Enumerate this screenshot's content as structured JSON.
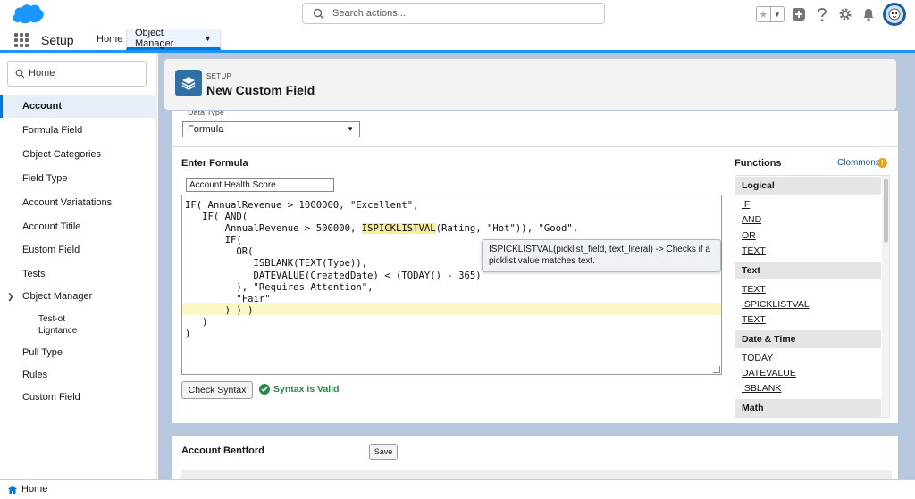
{
  "header": {
    "search_placeholder": "Search actions...",
    "icons": [
      "salesforce-cloud-logo",
      "star-icon",
      "plus-icon",
      "help-icon",
      "gear-icon",
      "bell-icon",
      "avatar"
    ]
  },
  "nav": {
    "app_name": "Setup",
    "tabs": [
      {
        "label": "Home"
      },
      {
        "label": "Object Manager"
      }
    ]
  },
  "sidebar": {
    "quickfind_value": "Home",
    "items": [
      {
        "label": "Account"
      },
      {
        "label": "Formula Field"
      },
      {
        "label": "Object Categories"
      },
      {
        "label": "Field Type"
      },
      {
        "label": "Account Variatations"
      },
      {
        "label": "Account Titile"
      },
      {
        "label": "Eustom Field"
      },
      {
        "label": "Tests"
      },
      {
        "label": "Object Manager"
      },
      {
        "label": "Test-ot"
      },
      {
        "label": "Ligntance"
      },
      {
        "label": "Pull Type"
      },
      {
        "label": "Rules"
      },
      {
        "label": "Custom Field"
      }
    ]
  },
  "page_header": {
    "eyebrow": "SETUP",
    "title": "New Custom Field"
  },
  "data_type": {
    "label": "Data Type",
    "value": "Formula"
  },
  "formula": {
    "section_title": "Enter Formula",
    "field_name": "Account Health Score",
    "code_lines": [
      "IF( AnnualRevenue > 1000000, \"Excellent\",",
      "   IF( AND(",
      "       AnnualRevenue > 500000, ",
      "       IF(",
      "         OR(",
      "            ISBLANK(TEXT(Type)),",
      "            DATEVALUE(CreatedDate) < (TODAY() - 365)",
      "         ), \"Requires Attention\",",
      "         \"Fair\"",
      "       ) ) )",
      "   )",
      ")"
    ],
    "code_line2_fn": "ISPICKLISTVAL",
    "code_line2_rest": "(Rating, \"Hot\")), \"Good\",",
    "tooltip": "ISPICKLISTVAL(picklist_field, text_literal) -> Checks if a picklist value matches text.",
    "check_button": "Check Syntax",
    "valid_text": "Syntax is Valid"
  },
  "functions": {
    "title": "Functions",
    "link": "Clommons",
    "categories": [
      {
        "name": "Logical",
        "items": [
          "IF",
          "AND",
          "OR",
          "TEXT"
        ]
      },
      {
        "name": "Text",
        "items": [
          "TEXT",
          "ISPICKLISTVAL",
          "TEXT"
        ]
      },
      {
        "name": "Date & Time",
        "items": [
          "TODAY",
          "DATEVALUE",
          "ISBLANK"
        ]
      },
      {
        "name": "Math",
        "items": []
      }
    ]
  },
  "lower_card": {
    "title": "Account Bentford",
    "save_button": "Save"
  },
  "footer": {
    "label": "Home"
  },
  "colors": {
    "brand": "#0176d3",
    "main_bg": "#b7c7de",
    "valid": "#2e844a",
    "highlight": "#fbf7c7"
  }
}
